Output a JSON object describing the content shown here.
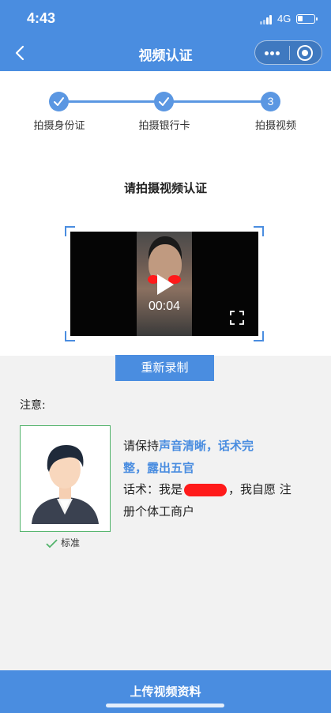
{
  "status_bar": {
    "time": "4:43",
    "network": "4G",
    "battery_level": 0.3
  },
  "nav": {
    "title": "视频认证"
  },
  "steps": [
    {
      "label": "拍摄身份证",
      "state": "done"
    },
    {
      "label": "拍摄银行卡",
      "state": "done"
    },
    {
      "label": "拍摄视频",
      "state": "current",
      "number": "3"
    }
  ],
  "section_title": "请拍摄视频认证",
  "video": {
    "duration": "00:04"
  },
  "retake_label": "重新录制",
  "notice": {
    "label": "注意:",
    "standard_label": "标准",
    "tip_prefix": "请保持",
    "tip_highlight_1": "声音清晰，话术完",
    "tip_highlight_2": "整，露出五官",
    "script_prefix": "话术：我是",
    "script_suffix": "，我自愿 注",
    "script_line2": "册个体工商户"
  },
  "upload_label": "上传视频资料",
  "colors": {
    "primary": "#4a8de0",
    "check": "#52b36b",
    "redaction": "#ff1a1a"
  }
}
